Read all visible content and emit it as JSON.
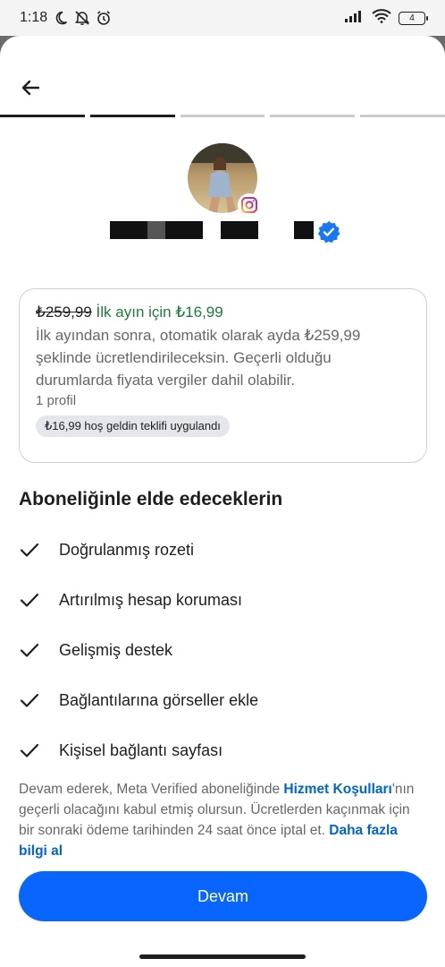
{
  "status_bar": {
    "time": "1:18",
    "battery_level": "4"
  },
  "progress": {
    "total_steps": 5,
    "completed_steps": 2
  },
  "profile": {
    "badge_icon": "instagram-icon",
    "verified_icon": "verified-badge-icon"
  },
  "offer": {
    "old_price": "₺259,99",
    "new_price_label": "İlk ayın için ₺16,99",
    "description": "İlk ayından sonra, otomatik olarak ayda ₺259,99 şeklinde ücretlendirileceksin. Geçerli olduğu durumlarda fiyata vergiler dahil olabilir.",
    "profile_count": "1 profil",
    "welcome_chip": "₺16,99 hoş geldin teklifi uygulandı"
  },
  "benefits": {
    "title": "Aboneliğinle elde edeceklerin",
    "items": [
      {
        "label": "Doğrulanmış rozeti"
      },
      {
        "label": "Artırılmış hesap koruması"
      },
      {
        "label": "Gelişmiş destek"
      },
      {
        "label": "Bağlantılarına görseller ekle"
      },
      {
        "label": "Kişisel bağlantı sayfası"
      }
    ]
  },
  "terms": {
    "text_1": "Devam ederek, Meta Verified aboneliğinde ",
    "link_1": "Hizmet Koşulları",
    "text_2": "'nın geçerli olacağını kabul etmiş olursun. Ücretlerden kaçınmak için bir sonraki ödeme tarihinden 24 saat önce iptal et. ",
    "link_2": "Daha fazla bilgi al"
  },
  "continue_button": {
    "label": "Devam"
  },
  "colors": {
    "primary": "#0866ff",
    "price_green": "#1f7a3a",
    "link": "#0064d1"
  }
}
